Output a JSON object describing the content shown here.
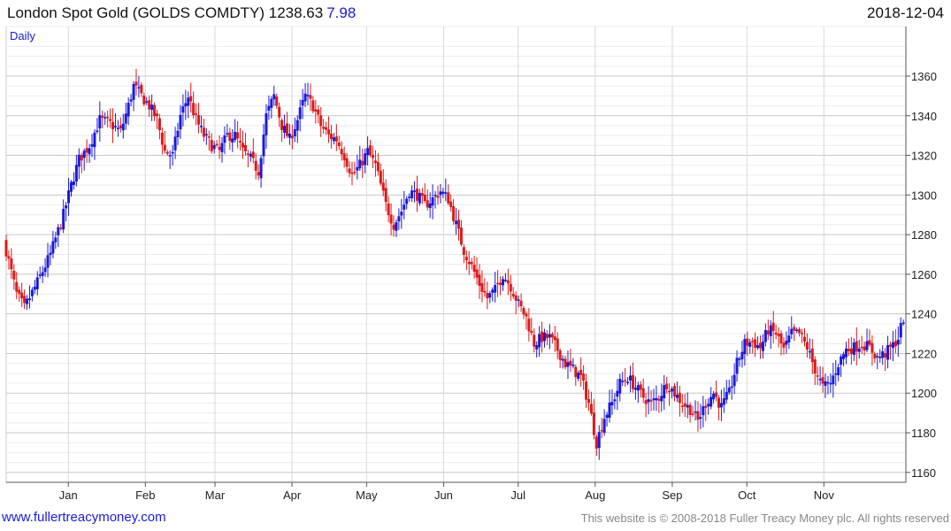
{
  "header": {
    "title": "London Spot Gold (GOLDS COMDTY)",
    "last": "1238.63",
    "change": "7.98",
    "date": "2018-12-04"
  },
  "footer": {
    "site": "www.fullertreacymoney.com",
    "copyright": "This website is © 2008-2018 Fuller Treacy Money plc. All rights reserved"
  },
  "colors": {
    "up": "#1a1adb",
    "down": "#dd1a1a",
    "change": "#1a1adb"
  },
  "chart_data": {
    "type": "ohlc",
    "period_label": "Daily",
    "ylim": [
      1155,
      1385
    ],
    "yticks": [
      1160,
      1180,
      1200,
      1220,
      1240,
      1260,
      1280,
      1300,
      1320,
      1340,
      1360
    ],
    "months": [
      {
        "label": "Jan",
        "day": 52
      },
      {
        "label": "Feb",
        "day": 83
      },
      {
        "label": "Mar",
        "day": 111
      },
      {
        "label": "Apr",
        "day": 142
      },
      {
        "label": "May",
        "day": 172
      },
      {
        "label": "Jun",
        "day": 203
      },
      {
        "label": "Jul",
        "day": 233
      },
      {
        "label": "Aug",
        "day": 264
      },
      {
        "label": "Sep",
        "day": 295
      },
      {
        "label": "Oct",
        "day": 325
      },
      {
        "label": "Nov",
        "day": 356
      }
    ],
    "day_range": [
      27,
      389
    ],
    "keypoints": [
      [
        0,
        1272
      ],
      [
        4,
        1250
      ],
      [
        7,
        1243
      ],
      [
        12,
        1256
      ],
      [
        17,
        1270
      ],
      [
        22,
        1290
      ],
      [
        25,
        1305
      ],
      [
        28,
        1318
      ],
      [
        32,
        1325
      ],
      [
        36,
        1338
      ],
      [
        40,
        1336
      ],
      [
        44,
        1332
      ],
      [
        47,
        1345
      ],
      [
        49,
        1355
      ],
      [
        52,
        1350
      ],
      [
        55,
        1345
      ],
      [
        58,
        1338
      ],
      [
        61,
        1322
      ],
      [
        64,
        1320
      ],
      [
        67,
        1340
      ],
      [
        70,
        1350
      ],
      [
        73,
        1338
      ],
      [
        76,
        1330
      ],
      [
        79,
        1325
      ],
      [
        82,
        1322
      ],
      [
        85,
        1330
      ],
      [
        88,
        1330
      ],
      [
        91,
        1322
      ],
      [
        94,
        1318
      ],
      [
        97,
        1312
      ],
      [
        100,
        1340
      ],
      [
        103,
        1350
      ],
      [
        106,
        1335
      ],
      [
        109,
        1328
      ],
      [
        112,
        1338
      ],
      [
        115,
        1350
      ],
      [
        118,
        1345
      ],
      [
        121,
        1335
      ],
      [
        124,
        1330
      ],
      [
        127,
        1328
      ],
      [
        130,
        1320
      ],
      [
        133,
        1310
      ],
      [
        136,
        1315
      ],
      [
        139,
        1322
      ],
      [
        142,
        1315
      ],
      [
        144,
        1305
      ],
      [
        146,
        1295
      ],
      [
        149,
        1285
      ],
      [
        152,
        1292
      ],
      [
        155,
        1302
      ],
      [
        158,
        1300
      ],
      [
        161,
        1295
      ],
      [
        164,
        1298
      ],
      [
        167,
        1302
      ],
      [
        170,
        1298
      ],
      [
        173,
        1285
      ],
      [
        176,
        1272
      ],
      [
        179,
        1264
      ],
      [
        182,
        1255
      ],
      [
        185,
        1248
      ],
      [
        188,
        1252
      ],
      [
        191,
        1260
      ],
      [
        194,
        1254
      ],
      [
        197,
        1245
      ],
      [
        200,
        1238
      ],
      [
        203,
        1225
      ],
      [
        206,
        1228
      ],
      [
        209,
        1228
      ],
      [
        212,
        1222
      ],
      [
        215,
        1215
      ],
      [
        218,
        1212
      ],
      [
        221,
        1208
      ],
      [
        224,
        1195
      ],
      [
        227,
        1175
      ],
      [
        230,
        1188
      ],
      [
        233,
        1195
      ],
      [
        236,
        1205
      ],
      [
        239,
        1208
      ],
      [
        242,
        1203
      ],
      [
        245,
        1198
      ],
      [
        248,
        1195
      ],
      [
        251,
        1198
      ],
      [
        254,
        1205
      ],
      [
        257,
        1200
      ],
      [
        260,
        1195
      ],
      [
        263,
        1192
      ],
      [
        266,
        1186
      ],
      [
        269,
        1195
      ],
      [
        272,
        1200
      ],
      [
        275,
        1193
      ],
      [
        278,
        1200
      ],
      [
        281,
        1215
      ],
      [
        284,
        1225
      ],
      [
        287,
        1226
      ],
      [
        290,
        1223
      ],
      [
        293,
        1232
      ],
      [
        296,
        1230
      ],
      [
        299,
        1222
      ],
      [
        302,
        1230
      ],
      [
        305,
        1230
      ],
      [
        308,
        1223
      ],
      [
        311,
        1212
      ],
      [
        314,
        1203
      ],
      [
        317,
        1205
      ],
      [
        320,
        1215
      ],
      [
        323,
        1222
      ],
      [
        326,
        1223
      ],
      [
        329,
        1225
      ],
      [
        332,
        1223
      ],
      [
        335,
        1218
      ],
      [
        338,
        1220
      ],
      [
        341,
        1224
      ],
      [
        343,
        1228
      ],
      [
        345,
        1238
      ]
    ]
  }
}
